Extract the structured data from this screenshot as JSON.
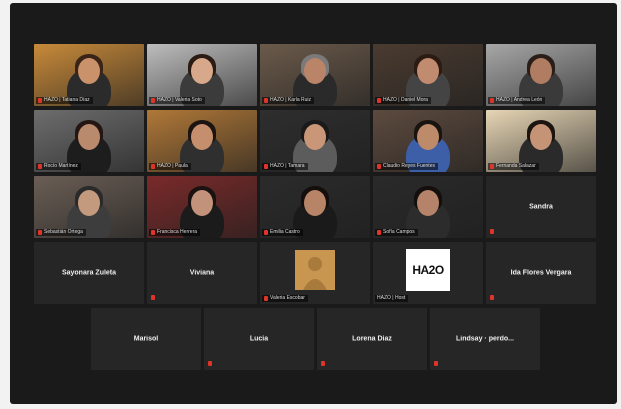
{
  "meeting": {
    "tiles_row1": [
      {
        "name": "HAZO | Tatiana Díaz",
        "bg": "#c88a3a",
        "skin": "#c9926b",
        "hair": "#3a2418",
        "shirt": "#2b2b2b"
      },
      {
        "name": "HAZO | Valeria Soto",
        "bg": "#bdbdbd",
        "skin": "#d7a98a",
        "hair": "#2a1c14",
        "shirt": "#3b3b3b"
      },
      {
        "name": "HAZO | Karla Ruiz",
        "bg": "#6b5a4a",
        "skin": "#b98468",
        "hair": "#7a7a7a",
        "shirt": "#2a2a2a",
        "active": true
      },
      {
        "name": "HAZO | Daniel Mora",
        "bg": "#4a3b30",
        "skin": "#c18b70",
        "hair": "#2b1b12",
        "shirt": "#444444"
      },
      {
        "name": "HAZO | Andrea León",
        "bg": "#a7a7a7",
        "skin": "#b07c62",
        "hair": "#2a1e18",
        "shirt": "#3a3a3a"
      }
    ],
    "tiles_row2": [
      {
        "name": "Rocío Martínez",
        "bg": "#6d6d6d",
        "skin": "#b98a6c",
        "hair": "#241612",
        "shirt": "#1d1d1d"
      },
      {
        "name": "HAZO | Paula",
        "bg": "#b07838",
        "skin": "#c58f6e",
        "hair": "#1c1410",
        "shirt": "#2f2f2f"
      },
      {
        "name": "HAZO | Tamara",
        "bg": "#2e2e2e",
        "skin": "#c99777",
        "hair": "#1a1a1a",
        "shirt": "#5c5c5c"
      },
      {
        "name": "Claudio Reyes Fuentes",
        "bg": "#5c4a3e",
        "skin": "#bd8a6a",
        "hair": "#1a1410",
        "shirt": "#3c5fa8"
      },
      {
        "name": "Fernanda Salazar",
        "bg": "#e7d6b5",
        "skin": "#c59476",
        "hair": "#1c1410",
        "shirt": "#2a2a2a"
      }
    ],
    "tiles_row3": [
      {
        "type": "video",
        "name": "Sebastián Ortega",
        "bg": "#6a5e55",
        "skin": "#c49a7e",
        "hair": "#2a2a2a",
        "shirt": "#3d3d3d"
      },
      {
        "type": "video",
        "name": "Francisca Herrera",
        "bg": "#7a2a2a",
        "skin": "#c2927a",
        "hair": "#1a1210",
        "shirt": "#1b1b1b"
      },
      {
        "type": "video",
        "name": "Emilia Castro",
        "bg": "#2b2b2b",
        "skin": "#b78468",
        "hair": "#140e0c",
        "shirt": "#1a1a1a"
      },
      {
        "type": "video",
        "name": "Sofía Campos",
        "bg": "#2a2a2a",
        "skin": "#b5836a",
        "hair": "#140e0c",
        "shirt": "#2c2c2c"
      },
      {
        "type": "name",
        "name": "Sandra"
      }
    ],
    "tiles_row4": [
      {
        "type": "name",
        "name": "Sayonara Zuleta",
        "muted": false
      },
      {
        "type": "name",
        "name": "Viviana",
        "muted": true
      },
      {
        "type": "avatar",
        "name": "Valeria Escobar"
      },
      {
        "type": "logo",
        "name": "HAZO | Host",
        "logo_text": "HA2O"
      },
      {
        "type": "name",
        "name": "Ida Flores Vergara",
        "muted": true
      }
    ],
    "tiles_row5": [
      {
        "name": "Marisol",
        "muted": false
      },
      {
        "name": "Lucía",
        "muted": true
      },
      {
        "name": "Lorena Díaz",
        "muted": true
      },
      {
        "name": "Lindsay · perdo...",
        "muted": true
      }
    ]
  }
}
